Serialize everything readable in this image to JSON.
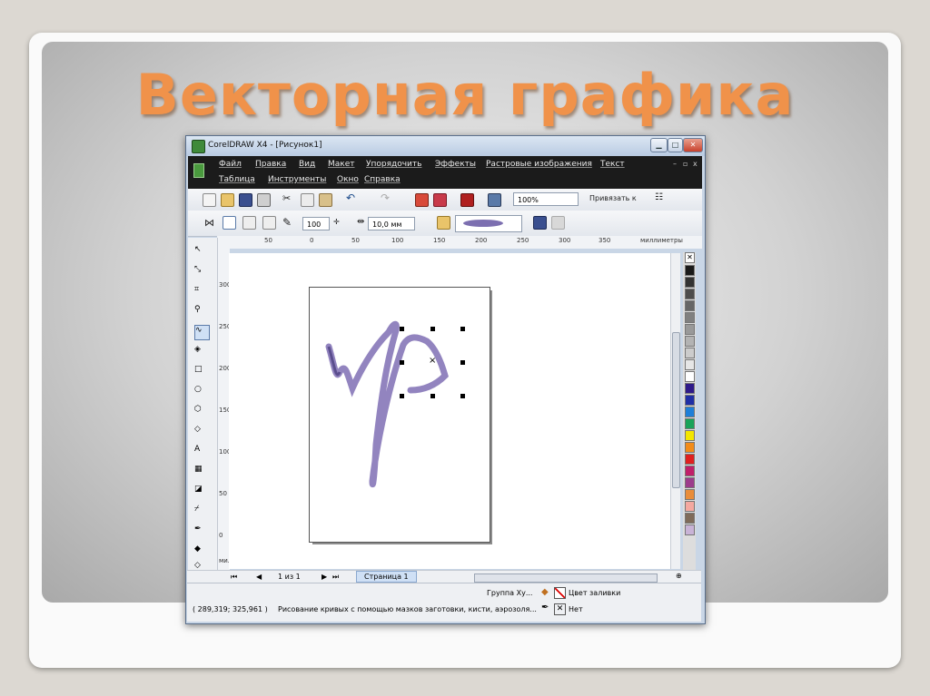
{
  "slide": {
    "title": "Векторная графика"
  },
  "window": {
    "title": "CorelDRAW X4 - [Рисунок1]",
    "controls": {
      "minimize": "▁",
      "maximize": "□",
      "close": "✕"
    },
    "accent": "#f0924a"
  },
  "menu": {
    "row1": [
      "Файл",
      "Правка",
      "Вид",
      "Макет",
      "Упорядочить",
      "Эффекты",
      "Растровые изображения",
      "Текст"
    ],
    "row2": [
      "Таблица",
      "Инструменты",
      "Окно",
      "Справка"
    ],
    "mdi": {
      "minimize": "–",
      "restore": "▫",
      "close": "x"
    }
  },
  "standard_toolbar": {
    "zoom_value": "100%",
    "snap_label": "Привязать к"
  },
  "property_bar": {
    "smoothing_value": "100",
    "width_value": "10,0 мм"
  },
  "ruler": {
    "h_ticks": [
      "50",
      "0",
      "50",
      "100",
      "150",
      "200",
      "250",
      "300",
      "350"
    ],
    "h_unit": "миллиметры",
    "v_ticks": [
      "300",
      "250",
      "200",
      "150",
      "100",
      "50",
      "0"
    ],
    "v_unit": "миллиметры"
  },
  "pagebar": {
    "page_counter": "1 из 1",
    "page_tab": "Страница 1"
  },
  "status": {
    "object_label": "Группа Ху...",
    "fill_label": "Цвет заливки",
    "coordinates": "( 289,319; 325,961 )",
    "hint": "Рисование кривых с помощью мазков заготовки, кисти, аэрозоля...",
    "outline_label": "Нет"
  },
  "palette_colors": [
    "#1a1a1a",
    "#333333",
    "#4d4d4d",
    "#666666",
    "#808080",
    "#999999",
    "#b3b3b3",
    "#cccccc",
    "#e6e6e6",
    "#ffffff",
    "#2e1a8a",
    "#1f2fa6",
    "#1e7fd8",
    "#19a35a",
    "#f3e600",
    "#f28c1a",
    "#e02020",
    "#c01f6a",
    "#9c3c8c",
    "#e98d3a",
    "#f4a8a0",
    "#7f6b5a",
    "#c9b3d6"
  ]
}
